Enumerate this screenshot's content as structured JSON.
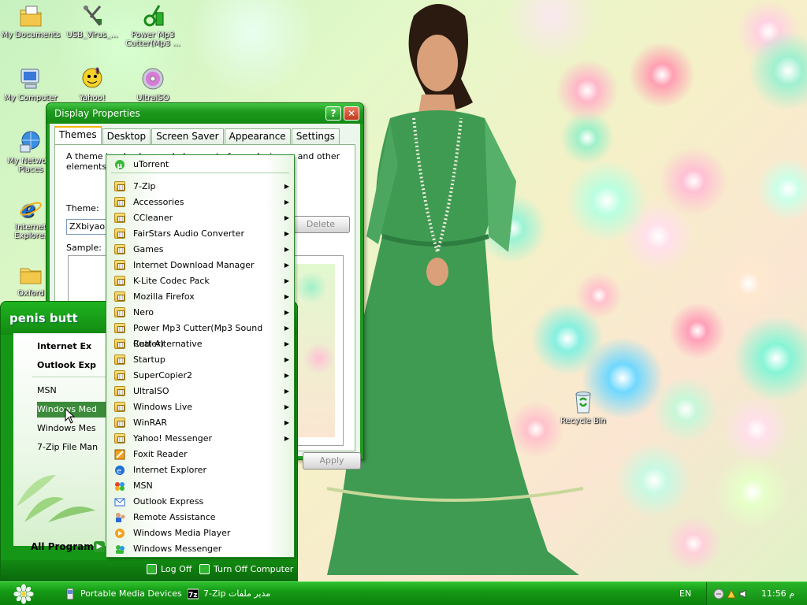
{
  "desktop": {
    "icons": [
      {
        "label": "My Documents",
        "icon": "folder-documents-icon"
      },
      {
        "label": "USB_Virus_...",
        "icon": "usb-virus-tool-icon"
      },
      {
        "label": "Power Mp3 Cutter(Mp3 ...",
        "icon": "power-mp3-cutter-icon"
      },
      {
        "label": "My Computer",
        "icon": "computer-icon"
      },
      {
        "label": "Yahoo!",
        "icon": "yahoo-messenger-icon"
      },
      {
        "label": "UltraISO",
        "icon": "ultraiso-disc-icon"
      },
      {
        "label": "My Network Places",
        "icon": "network-places-icon"
      },
      {
        "label": "Internet Explorer",
        "icon": "internet-explorer-icon"
      },
      {
        "label": "Oxford",
        "icon": "folder-icon"
      },
      {
        "label": "Recycle Bin",
        "icon": "recycle-bin-icon"
      }
    ]
  },
  "display_properties": {
    "title": "Display Properties",
    "help_label": "?",
    "close_label": "✕",
    "tabs": [
      "Themes",
      "Desktop",
      "Screen Saver",
      "Appearance",
      "Settings"
    ],
    "description": "A theme is a background plus a set of sounds, icons, and other elements to help you",
    "theme_label": "Theme:",
    "theme_value": "ZXbiyao",
    "delete_label": "Delete",
    "sample_label": "Sample:",
    "apply_label": "Apply"
  },
  "start_menu": {
    "user": "penis butt",
    "left_items": [
      {
        "label": "Internet Ex",
        "bold": true
      },
      {
        "label": "Outlook Exp",
        "bold": true
      },
      {
        "label": "MSN",
        "bold": false
      },
      {
        "label": "Windows Med",
        "bold": false
      },
      {
        "label": "Windows Mes",
        "bold": false
      },
      {
        "label": "7-Zip File Man",
        "bold": false
      }
    ],
    "all_programs_label": "All Programs",
    "log_off_label": "Log Off",
    "turn_off_label": "Turn Off Computer"
  },
  "programs": {
    "pinned": "uTorrent",
    "folders": [
      "7-Zip",
      "Accessories",
      "CCleaner",
      "FairStars Audio Converter",
      "Games",
      "Internet Download Manager",
      "K-Lite Codec Pack",
      "Mozilla Firefox",
      "Nero",
      "Power Mp3 Cutter(Mp3 Sound Cutter)",
      "Real Alternative",
      "Startup",
      "SuperCopier2",
      "UltraISO",
      "Windows Live",
      "WinRAR",
      "Yahoo! Messenger"
    ],
    "apps": [
      "Foxit Reader",
      "Internet Explorer",
      "MSN",
      "Outlook Express",
      "Remote Assistance",
      "Windows Media Player",
      "Windows Messenger"
    ]
  },
  "taskbar": {
    "tasks": [
      "Portable Media Devices",
      "7-Zip مدير ملفات"
    ],
    "language": "EN",
    "clock": "11:56 م"
  },
  "colors": {
    "theme_green": "#169616",
    "highlight": "#3b8b3b"
  }
}
